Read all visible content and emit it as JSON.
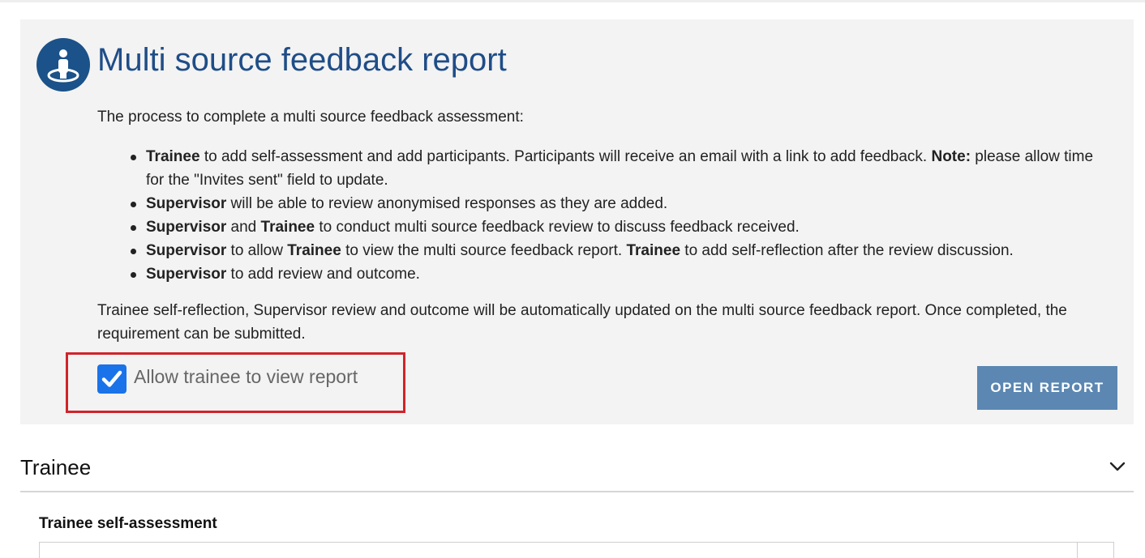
{
  "header": {
    "icon": "person-target-icon",
    "title": "Multi source feedback report"
  },
  "intro": "The process to complete a multi source feedback assessment:",
  "steps": [
    {
      "parts": [
        {
          "text": "Trainee",
          "bold": true
        },
        {
          "text": " to add self-assessment and add participants. Participants will receive an email with a link to add feedback. ",
          "bold": false
        },
        {
          "text": "Note:",
          "bold": true
        },
        {
          "text": " please allow time for the \"Invites sent\" field to update.",
          "bold": false
        }
      ]
    },
    {
      "parts": [
        {
          "text": "Supervisor",
          "bold": true
        },
        {
          "text": " will be able to review anonymised responses as they are added.",
          "bold": false
        }
      ]
    },
    {
      "parts": [
        {
          "text": "Supervisor",
          "bold": true
        },
        {
          "text": " and ",
          "bold": false
        },
        {
          "text": "Trainee",
          "bold": true
        },
        {
          "text": " to conduct multi source feedback review to discuss feedback received.",
          "bold": false
        }
      ]
    },
    {
      "parts": [
        {
          "text": "Supervisor",
          "bold": true
        },
        {
          "text": " to allow ",
          "bold": false
        },
        {
          "text": "Trainee",
          "bold": true
        },
        {
          "text": " to view the multi source feedback report. ",
          "bold": false
        },
        {
          "text": "Trainee",
          "bold": true
        },
        {
          "text": " to add self-reflection after the review discussion.",
          "bold": false
        }
      ]
    },
    {
      "parts": [
        {
          "text": "Supervisor",
          "bold": true
        },
        {
          "text": " to add review and outcome.",
          "bold": false
        }
      ]
    }
  ],
  "outro": "Trainee self-reflection, Supervisor review and outcome will be automatically updated on the multi source feedback report. Once completed, the requirement can be submitted.",
  "allow_view": {
    "label": "Allow trainee to view report",
    "checked": true
  },
  "open_report_button": "OPEN REPORT",
  "trainee_section": {
    "title": "Trainee",
    "subsection_title": "Trainee self-assessment"
  },
  "colors": {
    "title": "#1f4d87",
    "icon_bg": "#1a5289",
    "checkbox": "#1a73e8",
    "button": "#5b87b2",
    "highlight": "#d2232a",
    "panel_bg": "#f3f3f3"
  }
}
